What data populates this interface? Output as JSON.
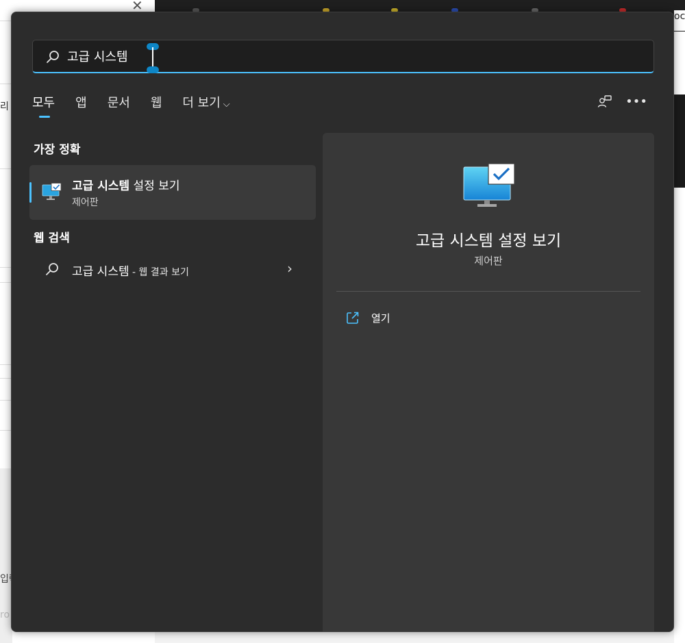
{
  "search": {
    "value": "고급 시스템",
    "placeholder": ""
  },
  "tabs": [
    {
      "label": "모두",
      "active": true
    },
    {
      "label": "앱",
      "active": false
    },
    {
      "label": "문서",
      "active": false
    },
    {
      "label": "웹",
      "active": false
    },
    {
      "label": "더 보기",
      "active": false
    }
  ],
  "sections": {
    "best_match": "가장 정확",
    "web_search": "웹 검색"
  },
  "best_match": {
    "title_bold": "고급 시스템",
    "title_rest": " 설정 보기",
    "subtitle": "제어판"
  },
  "web_result": {
    "query": "고급 시스템",
    "suffix": " - 웹 결과 보기"
  },
  "detail": {
    "title": "고급 시스템 설정 보기",
    "subtitle": "제어판",
    "actions": [
      {
        "label": "열기",
        "icon": "open-external-icon"
      }
    ]
  },
  "background": {
    "left_text_1": "리",
    "left_text_2": "입력",
    "left_text_3": "ro",
    "right_text": "oc"
  },
  "colors": {
    "accent": "#4cc2ff",
    "panel_bg": "#2c2c2c",
    "detail_bg": "#383838"
  }
}
